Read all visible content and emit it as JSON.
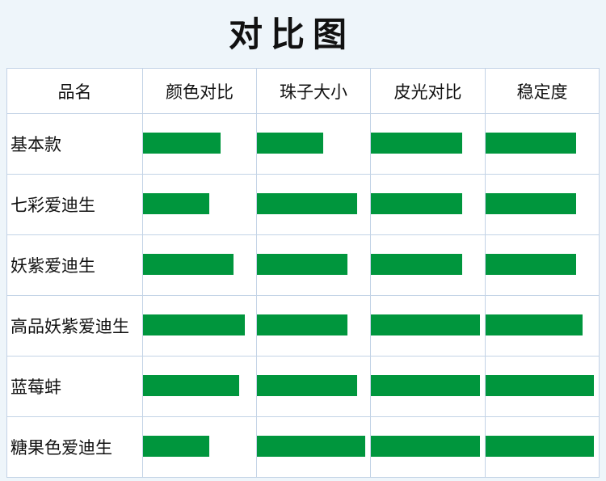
{
  "chart_data": {
    "type": "table",
    "title": "对比图",
    "columns": [
      "品名",
      "颜色对比",
      "珠子大小",
      "皮光对比",
      "稳定度"
    ],
    "rows": [
      {
        "name": "基本款",
        "values": [
          0.69,
          0.59,
          0.8,
          0.8
        ]
      },
      {
        "name": "七彩爱迪生",
        "values": [
          0.59,
          0.89,
          0.8,
          0.8
        ]
      },
      {
        "name": "妖紫爱迪生",
        "values": [
          0.8,
          0.8,
          0.8,
          0.8
        ]
      },
      {
        "name": "高品妖紫爱迪生",
        "values": [
          0.9,
          0.8,
          0.96,
          0.86
        ]
      },
      {
        "name": "蓝莓蚌",
        "values": [
          0.85,
          0.89,
          0.96,
          0.96
        ]
      },
      {
        "name": "糖果色爱迪生",
        "values": [
          0.59,
          0.96,
          0.96,
          0.96
        ]
      }
    ],
    "bar_color": "#00963d"
  }
}
